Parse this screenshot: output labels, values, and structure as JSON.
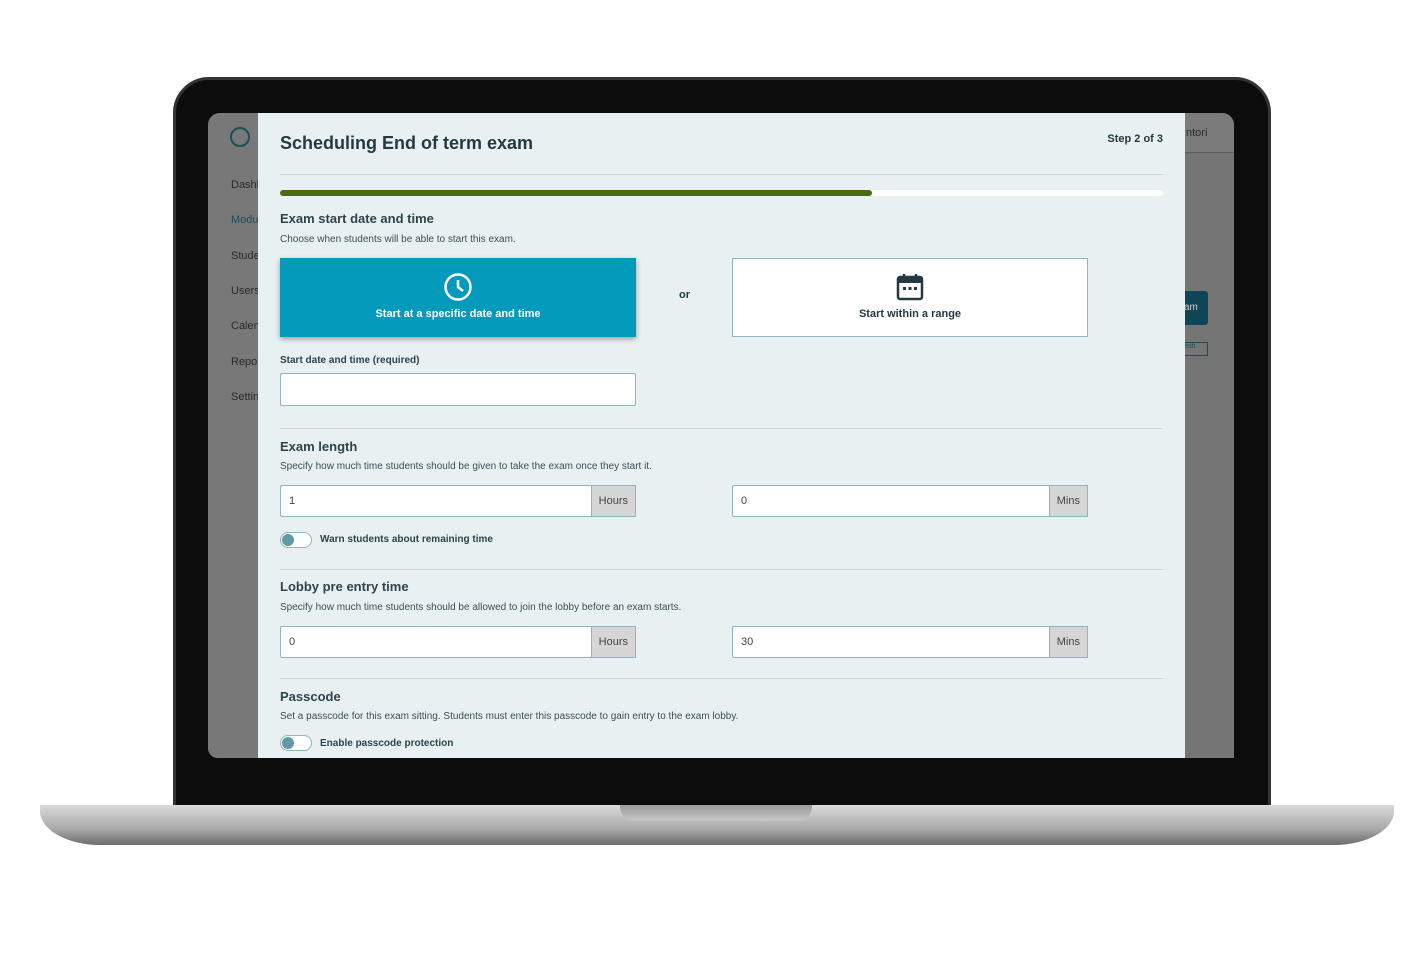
{
  "background_app": {
    "sidebar": [
      "Dashb",
      "Modu",
      "Stude",
      "Users",
      "Calen",
      "Repor",
      "Settin"
    ],
    "user_menu": "ntori",
    "button": "am",
    "small_button": "esh"
  },
  "modal": {
    "title": "Scheduling End of term exam",
    "step": "Step 2 of 3",
    "progress_percent": 67,
    "start": {
      "heading": "Exam start date and time",
      "description": "Choose when students will be able to start this exam.",
      "option_specific": "Start at a specific date and time",
      "or": "or",
      "option_range": "Start within a range",
      "field_label": "Start date and time (required)",
      "field_value": ""
    },
    "length": {
      "heading": "Exam length",
      "description": "Specify how much time students should be given to take the exam once they start it.",
      "hours_value": "1",
      "hours_unit": "Hours",
      "mins_value": "0",
      "mins_unit": "Mins",
      "toggle_label": "Warn students about remaining time"
    },
    "lobby": {
      "heading": "Lobby pre entry time",
      "description": "Specify how much time students should be allowed to join the lobby before an exam starts.",
      "hours_value": "0",
      "hours_unit": "Hours",
      "mins_value": "30",
      "mins_unit": "Mins"
    },
    "passcode": {
      "heading": "Passcode",
      "description": "Set a passcode for this exam sitting. Students must enter this passcode to gain entry to the exam lobby.",
      "toggle_label": "Enable passcode protection"
    }
  },
  "colors": {
    "accent": "#049abc",
    "progress": "#4b6b12"
  }
}
